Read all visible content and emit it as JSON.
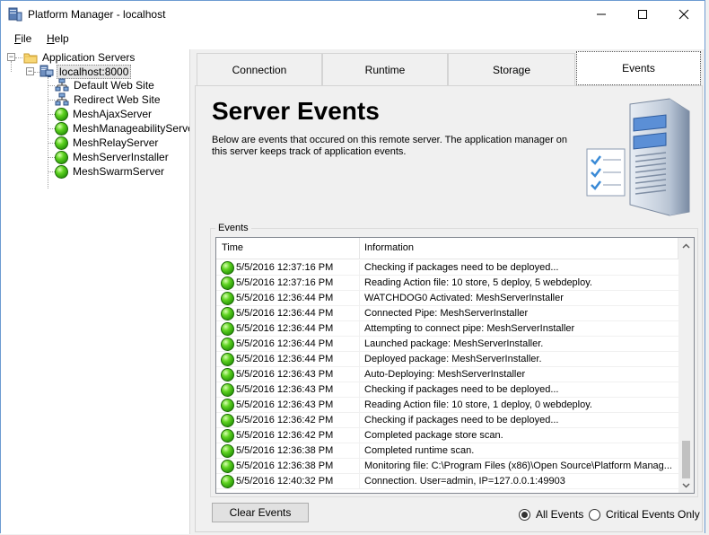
{
  "window": {
    "title": "Platform Manager - localhost"
  },
  "menu": {
    "file": "File",
    "help": "Help"
  },
  "tree": {
    "root": "Application Servers",
    "host": "localhost:8000",
    "children": [
      {
        "label": "Default Web Site",
        "icon": "network-site-icon"
      },
      {
        "label": "Redirect Web Site",
        "icon": "network-site-icon"
      },
      {
        "label": "MeshAjaxServer",
        "icon": "green-status-icon"
      },
      {
        "label": "MeshManageabilityServer",
        "icon": "green-status-icon"
      },
      {
        "label": "MeshRelayServer",
        "icon": "green-status-icon"
      },
      {
        "label": "MeshServerInstaller",
        "icon": "green-status-icon"
      },
      {
        "label": "MeshSwarmServer",
        "icon": "green-status-icon"
      }
    ]
  },
  "tabs": [
    {
      "label": "Connection"
    },
    {
      "label": "Runtime"
    },
    {
      "label": "Storage"
    },
    {
      "label": "Events"
    }
  ],
  "active_tab": "Events",
  "page": {
    "title": "Server Events",
    "description": "Below are events that occured on this remote server. The application manager on this server keeps track of application events."
  },
  "events": {
    "group_title": "Events",
    "columns": {
      "time": "Time",
      "info": "Information"
    },
    "rows": [
      {
        "time": "5/5/2016 12:37:16 PM",
        "info": "Checking if packages need to be deployed..."
      },
      {
        "time": "5/5/2016 12:37:16 PM",
        "info": "Reading Action file: 10 store, 5 deploy, 5 webdeploy."
      },
      {
        "time": "5/5/2016 12:36:44 PM",
        "info": "WATCHDOG0 Activated: MeshServerInstaller"
      },
      {
        "time": "5/5/2016 12:36:44 PM",
        "info": "Connected Pipe: MeshServerInstaller"
      },
      {
        "time": "5/5/2016 12:36:44 PM",
        "info": "Attempting to connect pipe: MeshServerInstaller"
      },
      {
        "time": "5/5/2016 12:36:44 PM",
        "info": "Launched package: MeshServerInstaller."
      },
      {
        "time": "5/5/2016 12:36:44 PM",
        "info": "Deployed package: MeshServerInstaller."
      },
      {
        "time": "5/5/2016 12:36:43 PM",
        "info": "Auto-Deploying: MeshServerInstaller"
      },
      {
        "time": "5/5/2016 12:36:43 PM",
        "info": "Checking if packages need to be deployed..."
      },
      {
        "time": "5/5/2016 12:36:43 PM",
        "info": "Reading Action file: 10 store, 1 deploy, 0 webdeploy."
      },
      {
        "time": "5/5/2016 12:36:42 PM",
        "info": "Checking if packages need to be deployed..."
      },
      {
        "time": "5/5/2016 12:36:42 PM",
        "info": "Completed package store scan."
      },
      {
        "time": "5/5/2016 12:36:38 PM",
        "info": "Completed runtime scan."
      },
      {
        "time": "5/5/2016 12:36:38 PM",
        "info": "Monitoring file: C:\\Program Files (x86)\\Open Source\\Platform Manag..."
      },
      {
        "time": "5/5/2016 12:40:32 PM",
        "info": "Connection. User=admin, IP=127.0.0.1:49903"
      }
    ]
  },
  "buttons": {
    "clear": "Clear Events"
  },
  "filters": {
    "all": "All Events",
    "critical": "Critical Events Only",
    "selected": "all"
  },
  "colors": {
    "status_green": "#3fbf12",
    "window_border": "#6d9bd1"
  }
}
